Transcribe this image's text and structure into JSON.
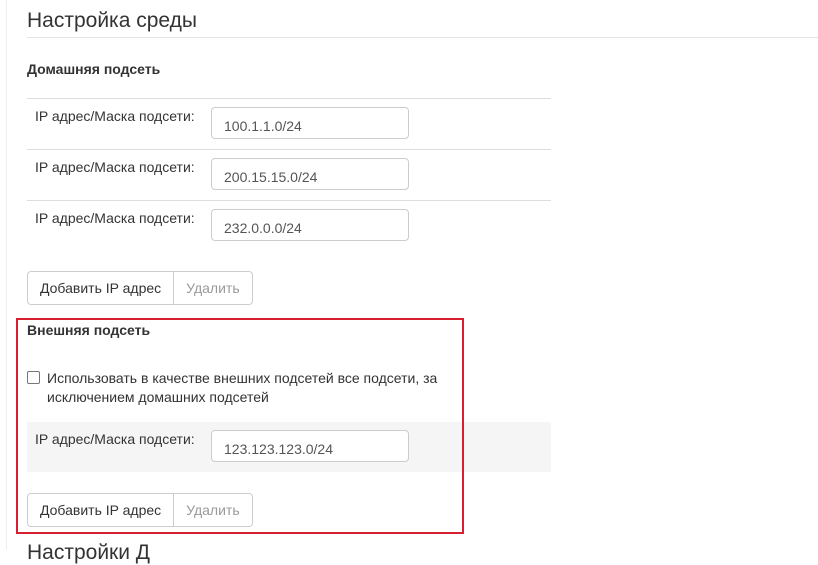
{
  "page": {
    "title": "Настройка среды"
  },
  "home_subnet": {
    "title": "Домашняя подсеть",
    "rows": [
      {
        "label": "IP адрес/Маска подсети:",
        "value": "100.1.1.0/24"
      },
      {
        "label": "IP адрес/Маска подсети:",
        "value": "200.15.15.0/24"
      },
      {
        "label": "IP адрес/Маска подсети:",
        "value": "232.0.0.0/24"
      }
    ],
    "add_label": "Добавить IP адрес",
    "delete_label": "Удалить"
  },
  "external_subnet": {
    "title": "Внешняя подсеть",
    "checkbox_label": "Использовать в качестве внешних подсетей все подсети, за исключением домашних подсетей",
    "checkbox_checked": false,
    "rows": [
      {
        "label": "IP адрес/Маска подсети:",
        "value": "123.123.123.0/24"
      }
    ],
    "add_label": "Добавить IP адрес",
    "delete_label": "Удалить"
  },
  "next_section": {
    "title": "Настройки Д"
  },
  "colors": {
    "highlight": "#d6202f",
    "row_shade": "#f5f5f5",
    "border": "#cccccc"
  }
}
